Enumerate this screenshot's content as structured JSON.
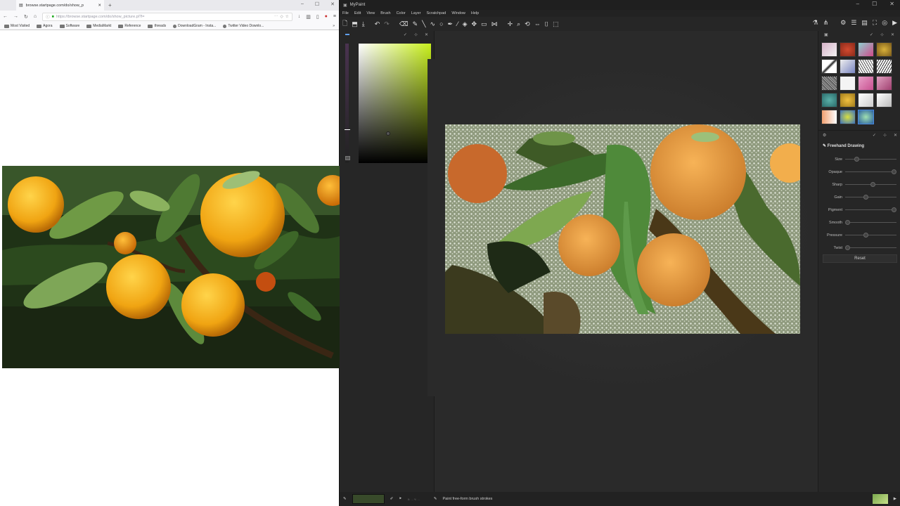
{
  "browser": {
    "tab_title": "browse.startpage.com/do/show_p",
    "url": "https://browse.startpage.com/do/show_picture.pl?l=",
    "bookmarks": [
      "Most Visited",
      "Agora",
      "Software",
      "MediaMarkt",
      "Reference",
      "threads",
      "DownloadGram - Insta...",
      "Twitter Video Downlo..."
    ]
  },
  "mypaint": {
    "title": "MyPaint",
    "menu": [
      "File",
      "Edit",
      "View",
      "Brush",
      "Color",
      "Layer",
      "Scratchpad",
      "Window",
      "Help"
    ],
    "brush_options": {
      "title": "Freehand Drawing",
      "rows": [
        {
          "label": "Size",
          "value": 0.2
        },
        {
          "label": "Opaque",
          "value": 1.0
        },
        {
          "label": "Sharp",
          "value": 0.55
        },
        {
          "label": "Gain",
          "value": 0.4
        },
        {
          "label": "Pigment",
          "value": 1.0
        },
        {
          "label": "Smooth",
          "value": 0.0
        },
        {
          "label": "Pressure",
          "value": 0.4
        },
        {
          "label": "Twist",
          "value": 0.0
        }
      ],
      "reset_label": "Reset"
    },
    "status": {
      "text": "Paint free-form brush strokes",
      "coords": "X: ... Y: ..."
    }
  },
  "colors": {
    "fg_swatch": "#384a2a"
  }
}
